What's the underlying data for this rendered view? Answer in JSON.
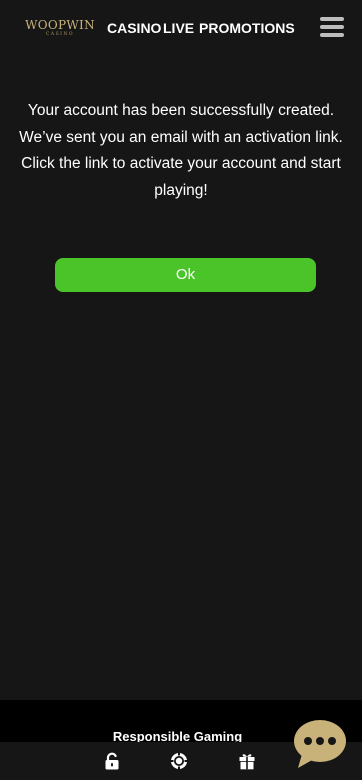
{
  "header": {
    "logo_text": "WOOPWIN",
    "logo_sub": "CASINO",
    "nav": [
      {
        "label": "CASINO"
      },
      {
        "label": "LIVE"
      },
      {
        "label": "PROMOTIONS"
      }
    ],
    "menu_icon": "hamburger-icon"
  },
  "message": {
    "text": "Your account has been successfully created. We’ve sent you an email with an activation link. Click the link to activate your account and start playing!"
  },
  "ok_button": {
    "label": "Ok"
  },
  "footer": {
    "responsible_label": "Responsible Gaming",
    "bar_icons": [
      "lock-icon",
      "chip-icon",
      "gift-icon"
    ],
    "chat_icon": "chat-bubble-icon"
  },
  "colors": {
    "background": "#161616",
    "accent_green": "#4bc42a",
    "logo_gold": "#c8b27a",
    "chat_bubble": "#c8b27a"
  }
}
